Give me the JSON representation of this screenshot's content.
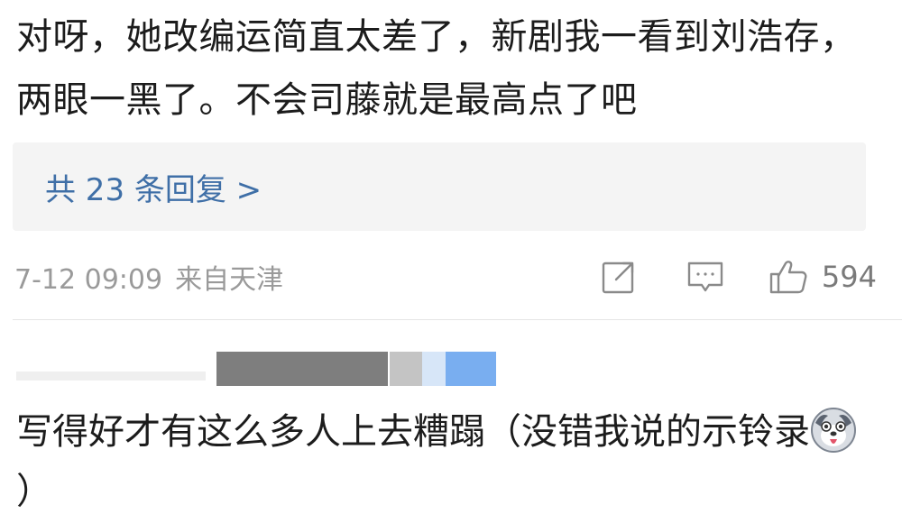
{
  "comment": {
    "text": "对呀，她改编运简直太差了，新剧我一看到刘浩存，两眼一黑了。不会司藤就是最高点了吧",
    "reply_summary": "共 23 条回复 >",
    "timestamp": "7-12 09:09",
    "location": "来自天津",
    "like_count": "594",
    "icons": {
      "share": "share-icon",
      "comment": "comment-icon",
      "like": "thumbs-up-icon"
    }
  },
  "next_comment": {
    "text_line": "写得好才有这么多人上去糟蹋（没错我说的示铃录",
    "text_tail": "）",
    "emoji": "husky-emoji-icon"
  },
  "colors": {
    "text": "#1c1c1c",
    "link": "#3f6fa7",
    "meta": "#9a9a9a",
    "reply_bg": "#f4f4f4",
    "divider": "#e6e6e6"
  }
}
